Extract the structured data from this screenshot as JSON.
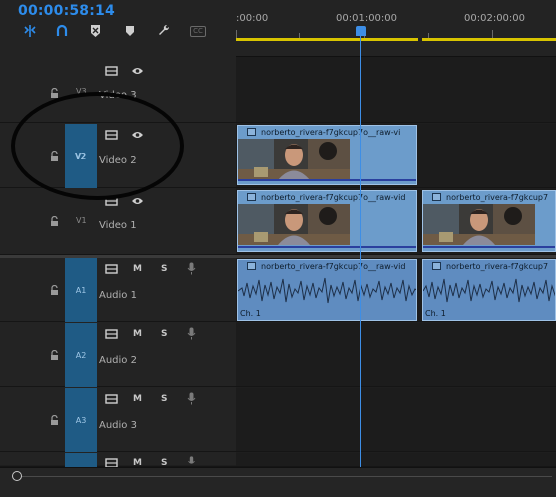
{
  "timecode": "00:00:58:14",
  "toolbar": {
    "tools": [
      "snap-icon",
      "linked-selection-icon",
      "add-marker-icon",
      "marker-icon",
      "wrench-icon",
      "captions-icon"
    ],
    "captions_label": "CC"
  },
  "ruler": {
    "labels": [
      ":00:00",
      "00:01:00:00",
      "00:02:00:00"
    ]
  },
  "tracks": {
    "v3": {
      "label": "V3",
      "name": "Video 3"
    },
    "v2": {
      "label": "V2",
      "name": "Video 2",
      "patch": "V2"
    },
    "v1": {
      "label": "V1",
      "name": "Video 1"
    },
    "a1": {
      "label": "A1",
      "name": "Audio 1",
      "patch": "A1",
      "mute": "M",
      "solo": "S"
    },
    "a2": {
      "label": "A2",
      "name": "Audio 2",
      "patch": "A2",
      "mute": "M",
      "solo": "S"
    },
    "a3": {
      "label": "A3",
      "name": "Audio 3",
      "patch": "A3",
      "mute": "M",
      "solo": "S"
    },
    "a4": {
      "mute": "M",
      "solo": "S"
    }
  },
  "clips": {
    "v2_clip": "norberto_rivera-f7gkcup7o__raw-vi",
    "v1_clip1": "norberto_rivera-f7gkcup7o__raw-vid",
    "v1_clip2": "norberto_rivera-f7gkcup7",
    "a1_clip1": "norberto_rivera-f7gkcup7o__raw-vid",
    "a1_clip2": "norberto_rivera-f7gkcup7",
    "channel_label": "Ch. 1"
  },
  "colors": {
    "accent": "#2d8ceb",
    "clip_video": "#6c9ccb",
    "clip_audio": "#5f8cc0",
    "patch": "#1f5b85",
    "workbar": "#d8c400"
  }
}
